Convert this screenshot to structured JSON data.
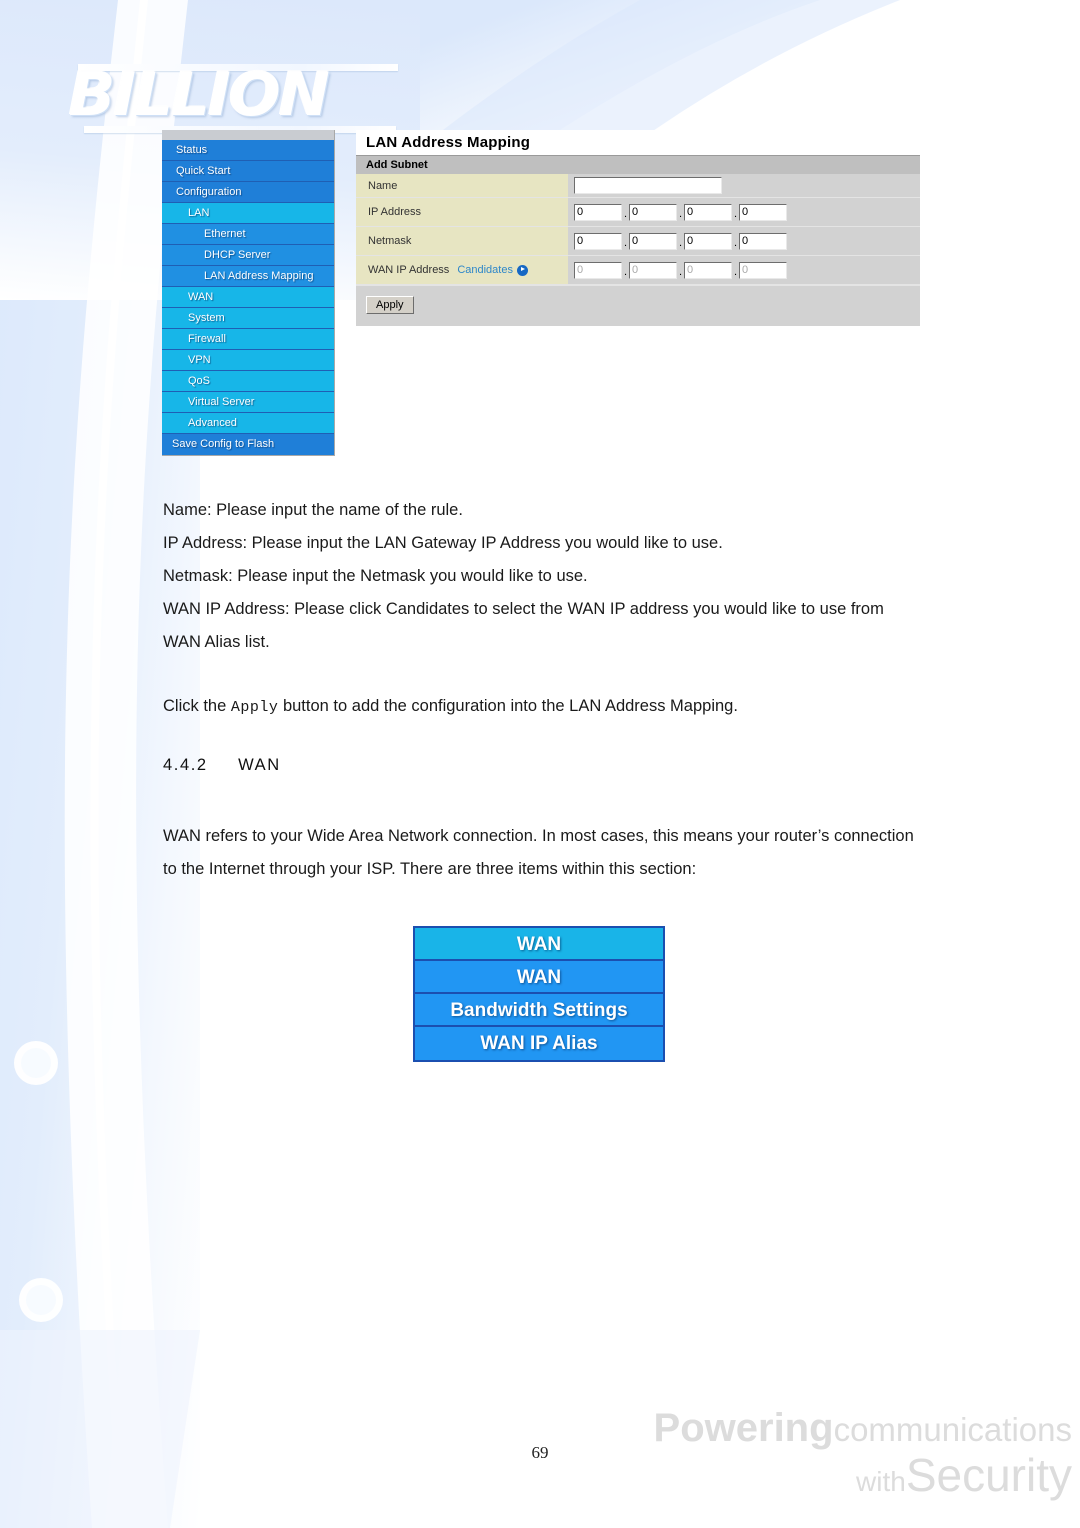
{
  "brand": {
    "logo_text": "BILLION",
    "watermark_powering": "Powering",
    "watermark_communications": "communications",
    "watermark_with": "with",
    "watermark_security": "Security"
  },
  "router_ui": {
    "sidebar": {
      "items": [
        {
          "label": "Status",
          "level": 0,
          "style": "blue"
        },
        {
          "label": "Quick Start",
          "level": 0,
          "style": "blue"
        },
        {
          "label": "Configuration",
          "level": 0,
          "style": "blue"
        },
        {
          "label": "LAN",
          "level": 1,
          "style": "cyan"
        },
        {
          "label": "Ethernet",
          "level": 2,
          "style": "blue-sub"
        },
        {
          "label": "DHCP Server",
          "level": 2,
          "style": "blue-sub"
        },
        {
          "label": "LAN Address Mapping",
          "level": 2,
          "style": "blue-sub"
        },
        {
          "label": "WAN",
          "level": 1,
          "style": "cyan"
        },
        {
          "label": "System",
          "level": 1,
          "style": "cyan"
        },
        {
          "label": "Firewall",
          "level": 1,
          "style": "cyan"
        },
        {
          "label": "VPN",
          "level": 1,
          "style": "cyan"
        },
        {
          "label": "QoS",
          "level": 1,
          "style": "cyan"
        },
        {
          "label": "Virtual Server",
          "level": 1,
          "style": "cyan"
        },
        {
          "label": "Advanced",
          "level": 1,
          "style": "cyan"
        },
        {
          "label": "Save Config to Flash",
          "level": 0,
          "style": "blue"
        }
      ]
    },
    "panel": {
      "title": "LAN Address Mapping",
      "subhead": "Add Subnet",
      "fields": {
        "name_label": "Name",
        "name_value": "",
        "ip_label": "IP Address",
        "ip_octets": [
          "0",
          "0",
          "0",
          "0"
        ],
        "netmask_label": "Netmask",
        "netmask_octets": [
          "0",
          "0",
          "0",
          "0"
        ],
        "wan_ip_label": "WAN IP Address",
        "candidates_link": "Candidates",
        "candidates_icon": "circle-arrow-right-icon",
        "wan_ip_octets": [
          "0",
          "0",
          "0",
          "0"
        ],
        "octet_separator": "."
      },
      "apply_label": "Apply"
    }
  },
  "document": {
    "paragraphs": [
      "Name: Please input the name of the rule.",
      "IP Address: Please input the LAN Gateway IP Address you would like to use.",
      "Netmask: Please input the Netmask you would like to use.",
      "WAN IP Address: Please click Candidates to select the WAN IP address you would like to use from WAN Alias list."
    ],
    "apply_sentence_before": "Click the ",
    "apply_sentence_mono": "Apply",
    "apply_sentence_after": " button to add the configuration into the LAN Address Mapping.",
    "section_number": "4.4.2",
    "section_title": "WAN",
    "wan_paragraph": "WAN refers to your Wide Area Network connection. In most cases, this means your router’s connection to the Internet through your ISP. There are three items within this section:"
  },
  "wan_menu": {
    "header": "WAN",
    "items": [
      "WAN",
      "Bandwidth Settings",
      "WAN IP Alias"
    ]
  },
  "footer": {
    "page_number": "69"
  },
  "colors": {
    "sidebar_blue": "#1f7fd8",
    "sidebar_cyan": "#17b6e8",
    "sidebar_sub_blue": "#2090e2",
    "label_bg": "#e7e5c2",
    "form_bg": "#d2d2d2",
    "subhead_bg": "#bfbfbf",
    "link_blue": "#2e87c9",
    "wan_box_border": "#1b4fb0"
  }
}
